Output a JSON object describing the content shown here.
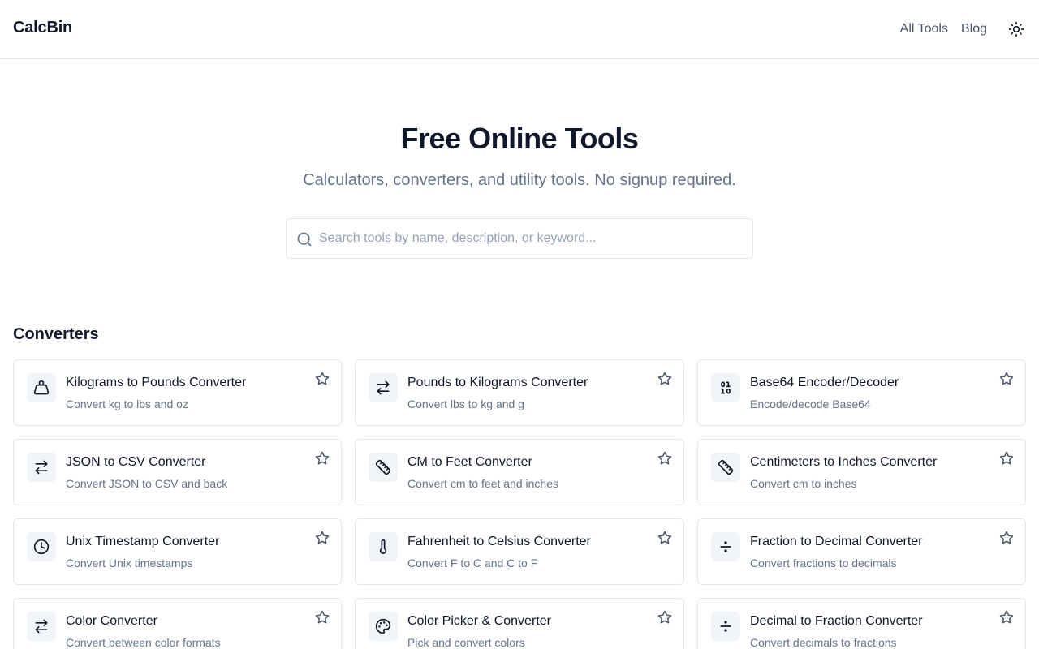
{
  "header": {
    "logo": "CalcBin",
    "nav": {
      "all_tools": "All Tools",
      "blog": "Blog"
    },
    "theme_icon": "sun-icon"
  },
  "hero": {
    "title": "Free Online Tools",
    "subtitle": "Calculators, converters, and utility tools. No signup required."
  },
  "search": {
    "placeholder": "Search tools by name, description, or keyword...",
    "value": "",
    "icon": "search-icon"
  },
  "section": {
    "title": "Converters"
  },
  "cards": [
    {
      "title": "Kilograms to Pounds Converter",
      "desc": "Convert kg to lbs and oz",
      "icon": "weight-icon"
    },
    {
      "title": "Pounds to Kilograms Converter",
      "desc": "Convert lbs to kg and g",
      "icon": "arrows-swap-icon"
    },
    {
      "title": "Base64 Encoder/Decoder",
      "desc": "Encode/decode Base64",
      "icon": "binary-icon"
    },
    {
      "title": "JSON to CSV Converter",
      "desc": "Convert JSON to CSV and back",
      "icon": "arrows-swap-icon"
    },
    {
      "title": "CM to Feet Converter",
      "desc": "Convert cm to feet and inches",
      "icon": "ruler-icon"
    },
    {
      "title": "Centimeters to Inches Converter",
      "desc": "Convert cm to inches",
      "icon": "ruler-icon"
    },
    {
      "title": "Unix Timestamp Converter",
      "desc": "Convert Unix timestamps",
      "icon": "clock-icon"
    },
    {
      "title": "Fahrenheit to Celsius Converter",
      "desc": "Convert F to C and C to F",
      "icon": "thermometer-icon"
    },
    {
      "title": "Fraction to Decimal Converter",
      "desc": "Convert fractions to decimals",
      "icon": "divide-icon"
    },
    {
      "title": "Color Converter",
      "desc": "Convert between color formats",
      "icon": "arrows-swap-icon"
    },
    {
      "title": "Color Picker & Converter",
      "desc": "Pick and convert colors",
      "icon": "palette-icon"
    },
    {
      "title": "Decimal to Fraction Converter",
      "desc": "Convert decimals to fractions",
      "icon": "divide-icon"
    }
  ]
}
